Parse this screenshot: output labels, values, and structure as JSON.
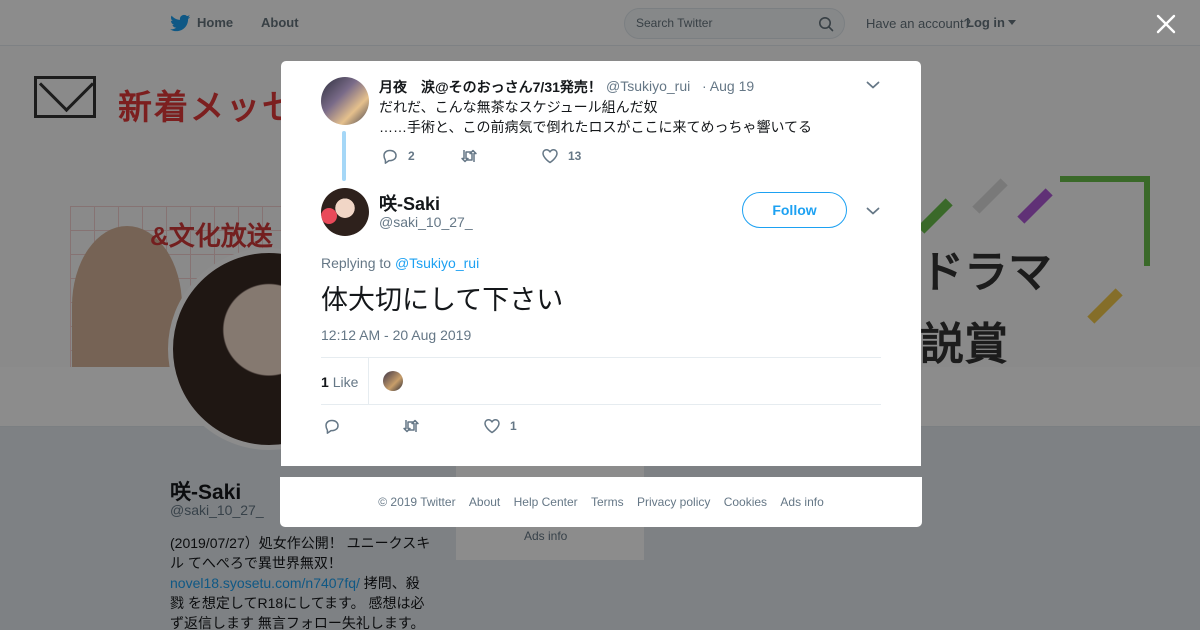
{
  "nav": {
    "home_label": "Home",
    "about_label": "About",
    "search_placeholder": "Search Twitter",
    "have_account": "Have an account?",
    "login_label": "Log in"
  },
  "profile": {
    "name": "咲-Saki",
    "handle": "@saki_10_27_",
    "bio_line1": "(2019/07/27）処女作公開！ ユニークスキル てへぺろで異世界無双！",
    "bio_link": "novel18.syosetu.com/n7407fq/",
    "bio_line2": " 拷問、殺戮 を想定してR18にしてます。 感想は必ず返信します 無言フォロー失礼します。",
    "side_ads": "Ads info"
  },
  "banner": {
    "title": "新着メッセ",
    "station": "&文化放送",
    "right_text1": "ドラマ",
    "right_text2": "説賞",
    "accent_colors": [
      "#e23a3a",
      "#6bc04b",
      "#b05ad8",
      "#f2c94c"
    ]
  },
  "parent_tweet": {
    "name": "月夜　涙@そのおっさん7/31発売！",
    "handle": "@Tsukiyo_rui",
    "date": "· Aug 19",
    "text": "だれだ、こんな無茶なスケジュール組んだ奴\n……手術と、この前病気で倒れたロスがここに来てめっちゃ響いてる",
    "replies": "2",
    "retweets": "",
    "likes": "13"
  },
  "main_tweet": {
    "name": "咲-Saki",
    "handle": "@saki_10_27_",
    "follow_label": "Follow",
    "replying_prefix": "Replying to",
    "replying_to": "@Tsukiyo_rui",
    "text": "体大切にして下さい",
    "timestamp": "12:12 AM - 20 Aug 2019",
    "like_count": "1",
    "like_label": "Like",
    "replies": "",
    "retweets": "",
    "likes": "1"
  },
  "footer": {
    "copyright": "© 2019 Twitter",
    "about": "About",
    "help": "Help Center",
    "terms": "Terms",
    "privacy": "Privacy policy",
    "cookies": "Cookies",
    "ads": "Ads info"
  },
  "colors": {
    "accent": "#1da1f2",
    "text_secondary": "#657786",
    "thread_line": "#a5d7f7"
  }
}
